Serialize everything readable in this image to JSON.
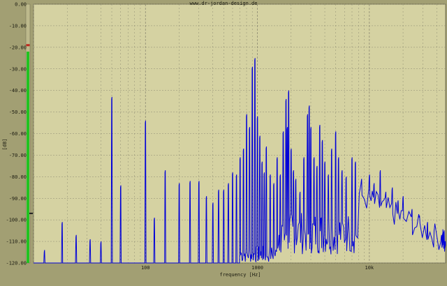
{
  "app": {
    "watermark": "www.dr-jordan-design.de"
  },
  "colors": {
    "background": "#a29f73",
    "plot_bg": "#d5d2a2",
    "grid": "#8d8b72",
    "spectrum": "#0000d8",
    "level_meter": "#21c321",
    "level_marker": "#c0281e"
  },
  "level_meter": {
    "level_db": -22,
    "peak_db": -19,
    "min_marker_db": -97
  },
  "chart_data": {
    "type": "line",
    "title": "www.dr-jordan-design.de",
    "xlabel": "frequency [Hz]",
    "ylabel": "[dB]",
    "xscale": "log",
    "xlim": [
      10,
      48000
    ],
    "ylim": [
      -120,
      0
    ],
    "grid": true,
    "y_ticks": [
      "0.00",
      "-10.00",
      "-20.00",
      "-30.00",
      "-40.00",
      "-50.00",
      "-60.00",
      "-70.00",
      "-80.00",
      "-90.00",
      "-100.00",
      "-110.00",
      "-120.00"
    ],
    "x_ticks": [
      "100",
      "1000",
      "10k"
    ],
    "peaks": [
      {
        "f": 12.5,
        "db": -115
      },
      {
        "f": 18,
        "db": -102
      },
      {
        "f": 24,
        "db": -108
      },
      {
        "f": 32,
        "db": -110
      },
      {
        "f": 40,
        "db": -111
      },
      {
        "f": 50,
        "db": -44
      },
      {
        "f": 60,
        "db": -85
      },
      {
        "f": 100,
        "db": -55
      },
      {
        "f": 120,
        "db": -100
      },
      {
        "f": 150,
        "db": -78
      },
      {
        "f": 200,
        "db": -84
      },
      {
        "f": 250,
        "db": -83
      },
      {
        "f": 300,
        "db": -83
      },
      {
        "f": 350,
        "db": -90
      },
      {
        "f": 400,
        "db": -93
      },
      {
        "f": 450,
        "db": -87
      },
      {
        "f": 500,
        "db": -87
      },
      {
        "f": 550,
        "db": -84
      },
      {
        "f": 600,
        "db": -79
      },
      {
        "f": 650,
        "db": -80
      },
      {
        "f": 700,
        "db": -72
      },
      {
        "f": 750,
        "db": -68
      },
      {
        "f": 800,
        "db": -52
      },
      {
        "f": 850,
        "db": -58
      },
      {
        "f": 900,
        "db": -30
      },
      {
        "f": 950,
        "db": -26
      },
      {
        "f": 1000,
        "db": -53
      },
      {
        "f": 1050,
        "db": -62
      },
      {
        "f": 1100,
        "db": -74
      },
      {
        "f": 1150,
        "db": -79
      },
      {
        "f": 1200,
        "db": -67
      },
      {
        "f": 1300,
        "db": -80
      },
      {
        "f": 1400,
        "db": -84
      },
      {
        "f": 1500,
        "db": -72
      },
      {
        "f": 1600,
        "db": -80
      },
      {
        "f": 1700,
        "db": -60
      },
      {
        "f": 1800,
        "db": -45
      },
      {
        "f": 1850,
        "db": -58
      },
      {
        "f": 1900,
        "db": -41
      },
      {
        "f": 2000,
        "db": -68
      },
      {
        "f": 2100,
        "db": -78
      },
      {
        "f": 2200,
        "db": -82
      },
      {
        "f": 2400,
        "db": -88
      },
      {
        "f": 2600,
        "db": -72
      },
      {
        "f": 2800,
        "db": -52
      },
      {
        "f": 2900,
        "db": -48
      },
      {
        "f": 3000,
        "db": -58
      },
      {
        "f": 3200,
        "db": -72
      },
      {
        "f": 3400,
        "db": -76
      },
      {
        "f": 3600,
        "db": -57
      },
      {
        "f": 3800,
        "db": -64
      },
      {
        "f": 4000,
        "db": -74
      },
      {
        "f": 4300,
        "db": -80
      },
      {
        "f": 4600,
        "db": -68
      },
      {
        "f": 5000,
        "db": -60
      },
      {
        "f": 5300,
        "db": -72
      },
      {
        "f": 5700,
        "db": -78
      },
      {
        "f": 6200,
        "db": -81
      },
      {
        "f": 7000,
        "db": -72
      },
      {
        "f": 7500,
        "db": -74
      },
      {
        "f": 8500,
        "db": -82
      },
      {
        "f": 10000,
        "db": -80
      },
      {
        "f": 11000,
        "db": -84
      },
      {
        "f": 12500,
        "db": -78
      },
      {
        "f": 14000,
        "db": -88
      },
      {
        "f": 16000,
        "db": -86
      },
      {
        "f": 18000,
        "db": -92
      },
      {
        "f": 20000,
        "db": -90
      },
      {
        "f": 24000,
        "db": -96
      },
      {
        "f": 28000,
        "db": -99
      },
      {
        "f": 33000,
        "db": -102
      },
      {
        "f": 38000,
        "db": -105
      },
      {
        "f": 44000,
        "db": -108
      }
    ]
  }
}
